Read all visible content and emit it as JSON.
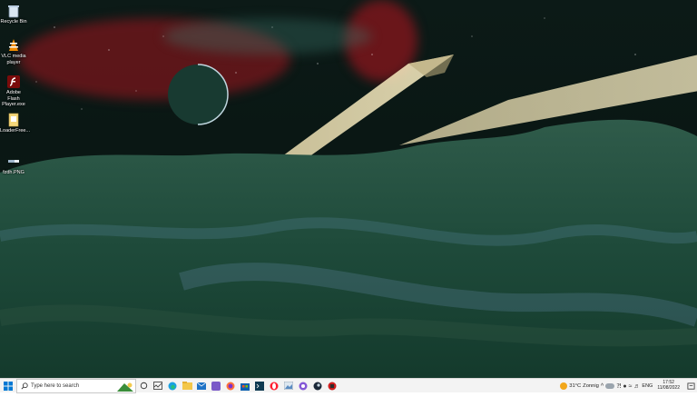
{
  "desktop": {
    "icons": [
      {
        "label": "Recycle Bin",
        "icon": "recycle-bin-icon"
      },
      {
        "label": "VLC media player",
        "icon": "vlc-cone-icon"
      },
      {
        "label": "Adobe Flash Player.exe",
        "icon": "flash-player-icon"
      },
      {
        "label": "LoaderFree...",
        "icon": "file-icon"
      },
      {
        "label": "fzdh.PNG",
        "icon": "image-file-icon"
      }
    ]
  },
  "taskbar": {
    "search_placeholder": "Type here to search",
    "pinned": [
      "task-view-icon",
      "task-manager-icon",
      "edge-icon",
      "file-explorer-icon",
      "mail-icon",
      "app-icon",
      "firefox-icon",
      "store-icon",
      "terminal-icon",
      "opera-icon",
      "photos-icon",
      "snipping-tool-icon",
      "steam-icon",
      "app-red-icon"
    ],
    "weather": {
      "temp": "31°C",
      "condition": "Zonnig"
    },
    "language": "ENG",
    "time": "17:52",
    "date": "11/08/2022"
  },
  "colors": {
    "taskbar_bg": "#f3f3f3",
    "accent_blue": "#0078d4"
  }
}
